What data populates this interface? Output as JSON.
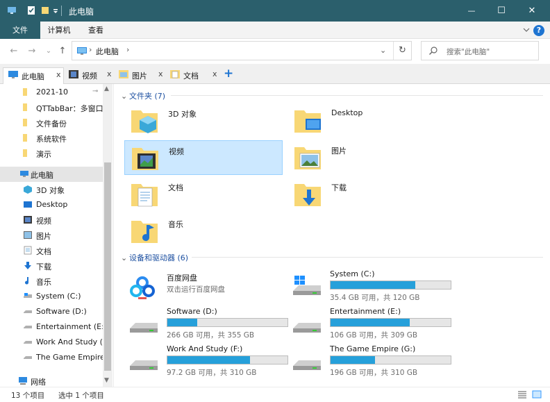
{
  "window": {
    "title": "此电脑",
    "controls": {
      "minimize": "—",
      "maximize": "☐",
      "close": "✕"
    }
  },
  "ribbon": {
    "tabs": [
      "文件",
      "计算机",
      "查看"
    ],
    "help": "?"
  },
  "address": {
    "crumb": "此电脑",
    "search_placeholder": "搜索\"此电脑\""
  },
  "tabs": [
    {
      "label": "此电脑",
      "close": "x"
    },
    {
      "label": "视频",
      "close": "x"
    },
    {
      "label": "图片",
      "close": "x"
    },
    {
      "label": "文档",
      "close": "x"
    }
  ],
  "new_tab": "+",
  "nav_pane": {
    "quick_access": [
      "2021-10",
      "QTTabBar：多窗口",
      "文件备份",
      "系统软件",
      "演示"
    ],
    "this_pc": "此电脑",
    "this_pc_items": [
      "3D 对象",
      "Desktop",
      "视频",
      "图片",
      "文档",
      "下载",
      "音乐",
      "System (C:)",
      "Software (D:)",
      "Entertainment (E:)",
      "Work And Study (F:)",
      "The Game Empire (G:)"
    ],
    "network": "网络"
  },
  "folders_group": {
    "header": "文件夹 (7)",
    "items": [
      "3D 对象",
      "Desktop",
      "视频",
      "图片",
      "文档",
      "下载",
      "音乐"
    ]
  },
  "devices_group": {
    "header": "设备和驱动器 (6)",
    "baidu": {
      "name": "百度网盘",
      "subtitle": "双击运行百度网盘"
    },
    "drives": [
      {
        "name": "System (C:)",
        "space": "35.4 GB 可用，共 120 GB",
        "used_fraction": 0.705
      },
      {
        "name": "Software (D:)",
        "space": "266 GB 可用，共 355 GB",
        "used_fraction": 0.25
      },
      {
        "name": "Entertainment (E:)",
        "space": "106 GB 可用，共 309 GB",
        "used_fraction": 0.657
      },
      {
        "name": "Work And Study (F:)",
        "space": "97.2 GB 可用，共 310 GB",
        "used_fraction": 0.686
      },
      {
        "name": "The Game Empire (G:)",
        "space": "196 GB 可用，共 310 GB",
        "used_fraction": 0.368
      }
    ]
  },
  "status": {
    "count": "13 个项目",
    "selected": "选中 1 个项目"
  },
  "colors": {
    "titlebar": "#2b5f6c",
    "accent": "#1e74d1",
    "drive_fill": "#26a0da",
    "folder": "#f8d775",
    "selection": "#cce8ff"
  }
}
